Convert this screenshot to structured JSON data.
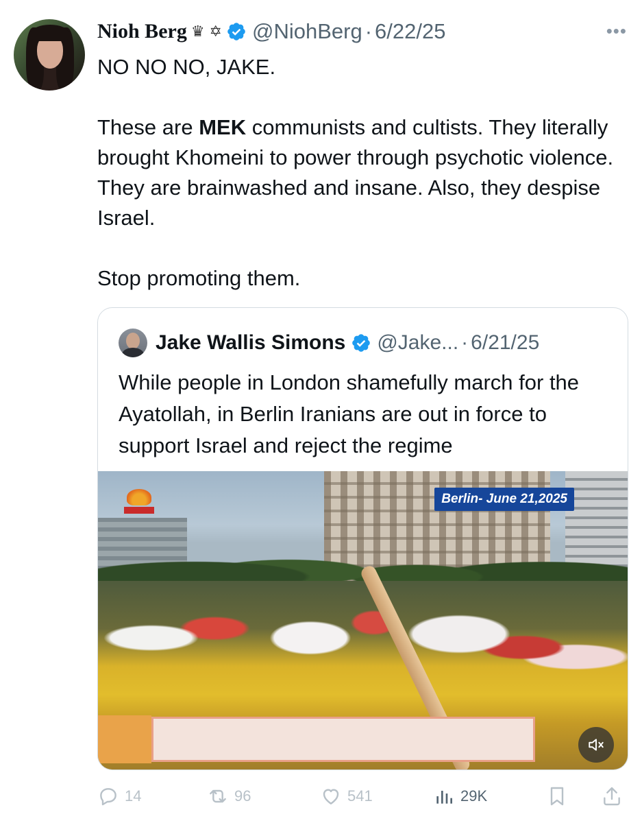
{
  "post": {
    "author_name": "Nioh Berg",
    "author_emojis": "♛ ✡",
    "handle": "@NiohBerg",
    "separator": "·",
    "date": "6/22/25",
    "more_label": "•••",
    "text": {
      "line1": "NO NO NO, JAKE.",
      "para2_prefix": "These are ",
      "para2_bold": "MEK",
      "para2_rest": " communists and cultists. They literally brought Khomeini to power through psychotic violence. They are brainwashed and insane. Also, they despise Israel.",
      "para3": "Stop promoting them."
    }
  },
  "quoted": {
    "author_name": "Jake Wallis Simons",
    "handle": "@Jake...",
    "separator": "·",
    "date": "6/21/25",
    "text": "While people in London shamefully march for the Ayatollah, in Berlin Iranians are out in force to support Israel and reject the regime",
    "media": {
      "overlay_label": "Berlin- June 21,2025",
      "muted": true
    }
  },
  "actions": {
    "replies": "14",
    "reposts": "96",
    "likes": "541",
    "views": "29K"
  },
  "colors": {
    "verified": "#1d9bf0",
    "secondary_text": "#536471",
    "faded_action": "#b8c1c8",
    "overlay_label_bg": "#16469a"
  },
  "icons": {
    "verified": "verified-badge-icon",
    "more": "more-options-icon",
    "reply": "reply-icon",
    "repost": "repost-icon",
    "like": "heart-icon",
    "views": "views-icon",
    "bookmark": "bookmark-icon",
    "share": "share-icon",
    "mute": "muted-speaker-icon"
  }
}
